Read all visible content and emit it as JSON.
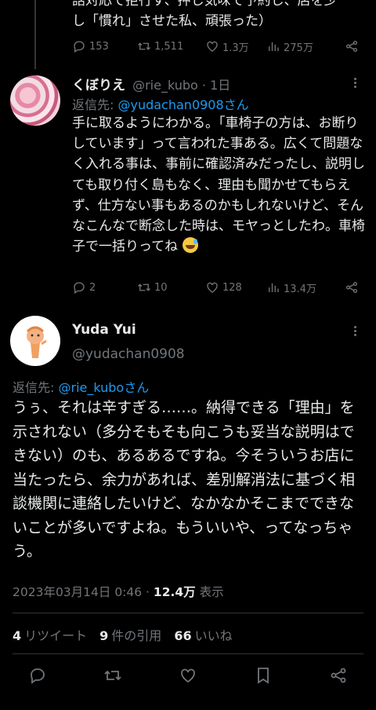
{
  "top_tweet": {
    "text_line1": "話対応で拒行す、押し気味で予約し、店を少",
    "text_line2": "し「慣れ」させた私、頑張った）",
    "replies": "153",
    "retweets": "1,511",
    "likes": "1.3万",
    "views": "275万"
  },
  "reply_tweet": {
    "name": "くぼりえ",
    "handle": "@rie_kubo",
    "time": "· 1日",
    "reply_prefix": "返信先: ",
    "reply_to": "@yudachan0908さん",
    "text": "手に取るようにわかる。「車椅子の方は、お断りしています」って言われた事ある。広くて問題なく入れる事は、事前に確認済みだったし、説明しても取り付く島もなく、理由も聞かせてもらえず、仕方ない事もあるのかもしれないけど、そんなこんなで断念した時は、モヤっとしたわ。車椅子で一括りってね",
    "replies": "2",
    "retweets": "10",
    "likes": "128",
    "views": "13.4万"
  },
  "main_tweet": {
    "name": "Yuda Yui",
    "handle": "@yudachan0908",
    "reply_prefix": "返信先: ",
    "reply_to": "@rie_kuboさん",
    "text": "うぅ、それは辛すぎる……。納得できる「理由」を示されない（多分そもそも向こうも妥当な説明はできない）のも、あるあるですね。今そういうお店に当たったら、余力があれば、差別解消法に基づく相談機関に連絡したいけど、なかなかそこまでできないことが多いですよね。もういいや、ってなっちゃう。",
    "date": "2023年03月14日 0:46 · ",
    "views_count": "12.4万",
    "views_label": " 表示",
    "retweet_count": "4",
    "retweet_label": "リツイート",
    "quote_count": "9",
    "quote_label": "件の引用",
    "like_count": "66",
    "like_label": "いいね"
  },
  "colors": {
    "background": "#000000",
    "text": "#e7e9ea",
    "muted": "#71767b",
    "link": "#1d9bf0"
  }
}
